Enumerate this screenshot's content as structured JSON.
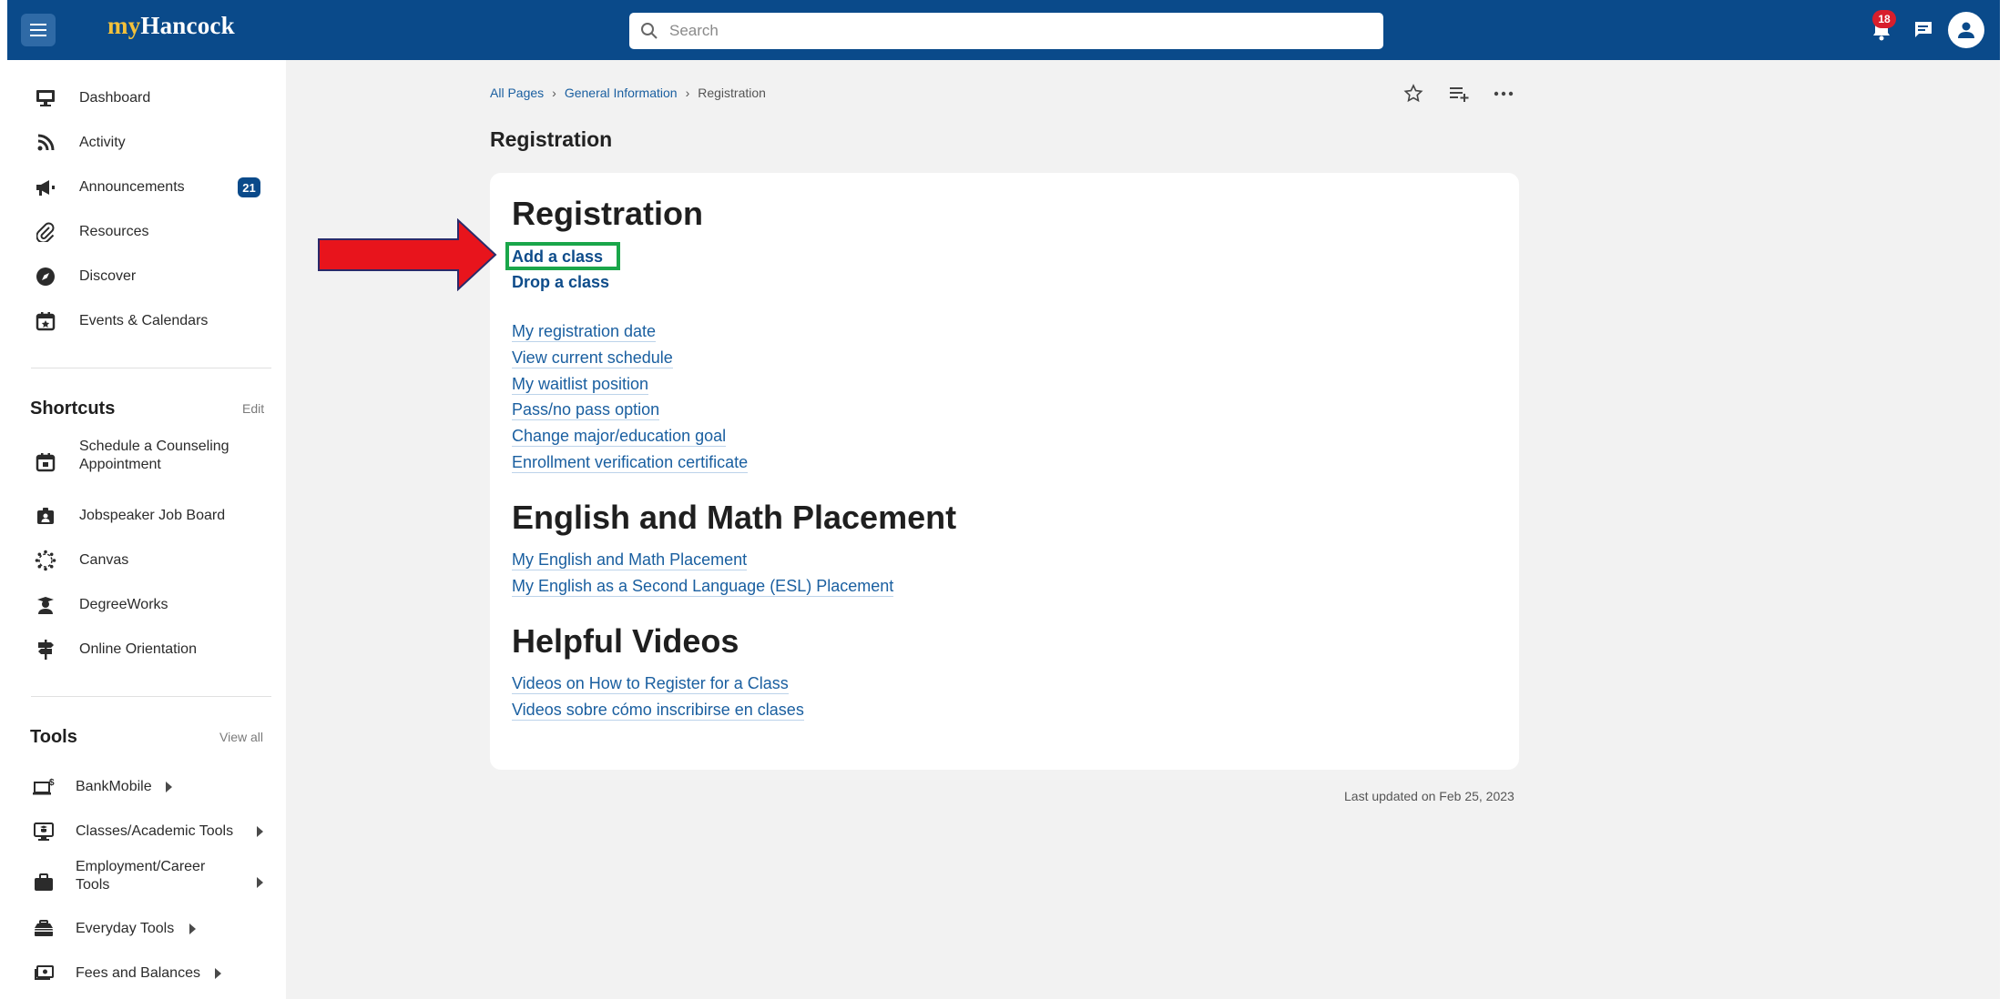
{
  "app": {
    "brand_prefix": "my",
    "brand_name": "Hancock",
    "accent_color": "#0a4a8a"
  },
  "header": {
    "search_placeholder": "Search",
    "notification_count": "18",
    "icons": [
      "menu-icon",
      "search-icon",
      "bell-icon",
      "chat-icon",
      "user-icon"
    ]
  },
  "sidebar": {
    "nav": [
      {
        "label": "Dashboard",
        "icon": "monitor-icon"
      },
      {
        "label": "Activity",
        "icon": "rss-icon"
      },
      {
        "label": "Announcements",
        "icon": "megaphone-icon",
        "badge": "21"
      },
      {
        "label": "Resources",
        "icon": "paperclip-icon"
      },
      {
        "label": "Discover",
        "icon": "compass-icon"
      },
      {
        "label": "Events & Calendars",
        "icon": "calendar-icon"
      }
    ],
    "shortcuts": {
      "title": "Shortcuts",
      "edit_label": "Edit",
      "items": [
        {
          "label_line1": "Schedule a Counseling",
          "label_line2": "Appointment",
          "icon": "calendar-icon"
        },
        {
          "label": "Jobspeaker Job Board",
          "icon": "badge-icon"
        },
        {
          "label": "Canvas",
          "icon": "canvas-icon"
        },
        {
          "label": "DegreeWorks",
          "icon": "graduate-icon"
        },
        {
          "label": "Online Orientation",
          "icon": "signpost-icon"
        }
      ]
    },
    "tools": {
      "title": "Tools",
      "view_all_label": "View all",
      "items": [
        {
          "label": "BankMobile",
          "icon": "laptop-dollar-icon"
        },
        {
          "label": "Classes/Academic Tools",
          "icon": "screen-book-icon"
        },
        {
          "label_line1": "Employment/Career",
          "label_line2": "Tools",
          "icon": "briefcase-icon"
        },
        {
          "label": "Everyday Tools",
          "icon": "toolbox-icon"
        },
        {
          "label": "Fees and Balances",
          "icon": "money-icon"
        }
      ]
    }
  },
  "breadcrumb": {
    "items": [
      "All Pages",
      "General Information"
    ],
    "current": "Registration"
  },
  "page": {
    "title": "Registration",
    "sections": [
      {
        "heading": "Registration",
        "primary_links": [
          "Add a class",
          "Drop a class"
        ],
        "links": [
          "My registration date",
          "View current schedule",
          "My waitlist position",
          "Pass/no pass option",
          "Change major/education goal",
          "Enrollment verification certificate"
        ]
      },
      {
        "heading": "English and Math Placement",
        "links": [
          "My English and Math Placement",
          "My English as a Second Language (ESL) Placement"
        ]
      },
      {
        "heading": "Helpful Videos",
        "links": [
          "Videos on How to Register for a Class",
          "Videos sobre cómo inscribirse en clases"
        ]
      }
    ],
    "last_updated": "Last updated on Feb 25, 2023"
  },
  "annotation": {
    "arrow_color": "#e8141c",
    "highlight_color": "#1aa64a"
  }
}
